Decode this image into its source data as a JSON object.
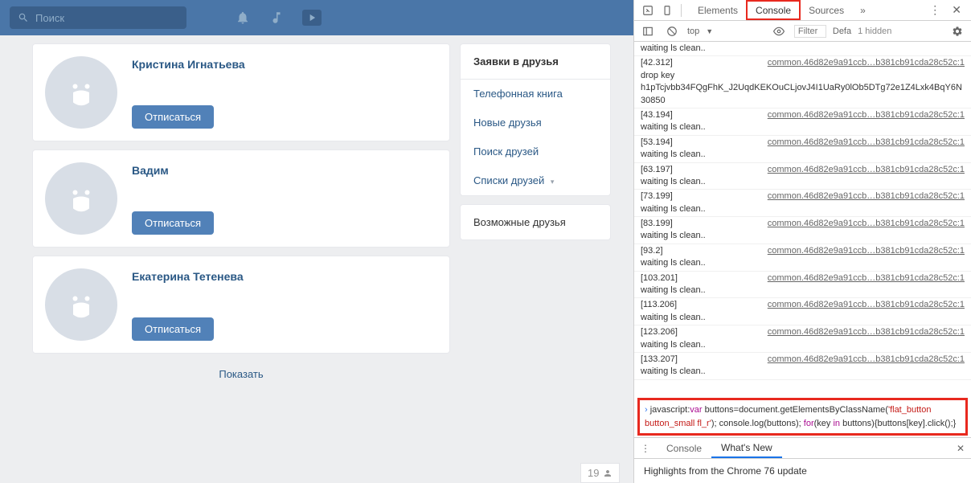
{
  "vk": {
    "search_placeholder": "Поиск",
    "friends": [
      {
        "name": "Кристина Игнатьева",
        "button": "Отписаться"
      },
      {
        "name": "Вадим",
        "button": "Отписаться"
      },
      {
        "name": "Екатерина Тетенева",
        "button": "Отписаться"
      }
    ],
    "show_more": "Показать",
    "sidebar": {
      "header": "Заявки в друзья",
      "phonebook": "Телефонная книга",
      "new_friends": "Новые друзья",
      "find_friends": "Поиск друзей",
      "lists": "Списки друзей"
    },
    "possible_friends": "Возможные друзья",
    "up_count": "19"
  },
  "devtools": {
    "tabs": {
      "elements": "Elements",
      "console": "Console",
      "sources": "Sources"
    },
    "context": "top",
    "filter_placeholder": "Filter",
    "default": "Defa",
    "hidden": "1 hidden",
    "log": [
      {
        "ts": "",
        "msg": "waiting ls clean..",
        "src": ""
      },
      {
        "ts": "[42.312]",
        "msg": "drop key h1pTcjvbb34FQgFhK_J2UqdKEKOuCLjovJ4I1UaRy0lOb5DTg72e1Z4Lxk4BqY6N 30850",
        "src": "common.46d82e9a91ccb…b381cb91cda28c52c:1"
      },
      {
        "ts": "[43.194]",
        "msg": "waiting ls clean..",
        "src": "common.46d82e9a91ccb…b381cb91cda28c52c:1"
      },
      {
        "ts": "[53.194]",
        "msg": "waiting ls clean..",
        "src": "common.46d82e9a91ccb…b381cb91cda28c52c:1"
      },
      {
        "ts": "[63.197]",
        "msg": "waiting ls clean..",
        "src": "common.46d82e9a91ccb…b381cb91cda28c52c:1"
      },
      {
        "ts": "[73.199]",
        "msg": "waiting ls clean..",
        "src": "common.46d82e9a91ccb…b381cb91cda28c52c:1"
      },
      {
        "ts": "[83.199]",
        "msg": "waiting ls clean..",
        "src": "common.46d82e9a91ccb…b381cb91cda28c52c:1"
      },
      {
        "ts": "[93.2]",
        "msg": "waiting ls clean..",
        "src": "common.46d82e9a91ccb…b381cb91cda28c52c:1"
      },
      {
        "ts": "[103.201]",
        "msg": "waiting ls clean..",
        "src": "common.46d82e9a91ccb…b381cb91cda28c52c:1"
      },
      {
        "ts": "[113.206]",
        "msg": "waiting ls clean..",
        "src": "common.46d82e9a91ccb…b381cb91cda28c52c:1"
      },
      {
        "ts": "[123.206]",
        "msg": "waiting ls clean..",
        "src": "common.46d82e9a91ccb…b381cb91cda28c52c:1"
      },
      {
        "ts": "[133.207]",
        "msg": "waiting ls clean..",
        "src": "common.46d82e9a91ccb…b381cb91cda28c52c:1"
      }
    ],
    "input": {
      "prefix": "javascript:",
      "kw1": "var",
      "t1": " buttons=document.getElementsByClassName(",
      "str": "'flat_button button_small fl_r'",
      "t2": "); console.log(buttons); ",
      "kw2": "for",
      "t3": "(key ",
      "kw3": "in",
      "t4": " buttons){buttons[key].click();}"
    },
    "drawer": {
      "console": "Console",
      "whatsnew": "What's New",
      "highlight": "Highlights from the Chrome 76 update"
    }
  }
}
